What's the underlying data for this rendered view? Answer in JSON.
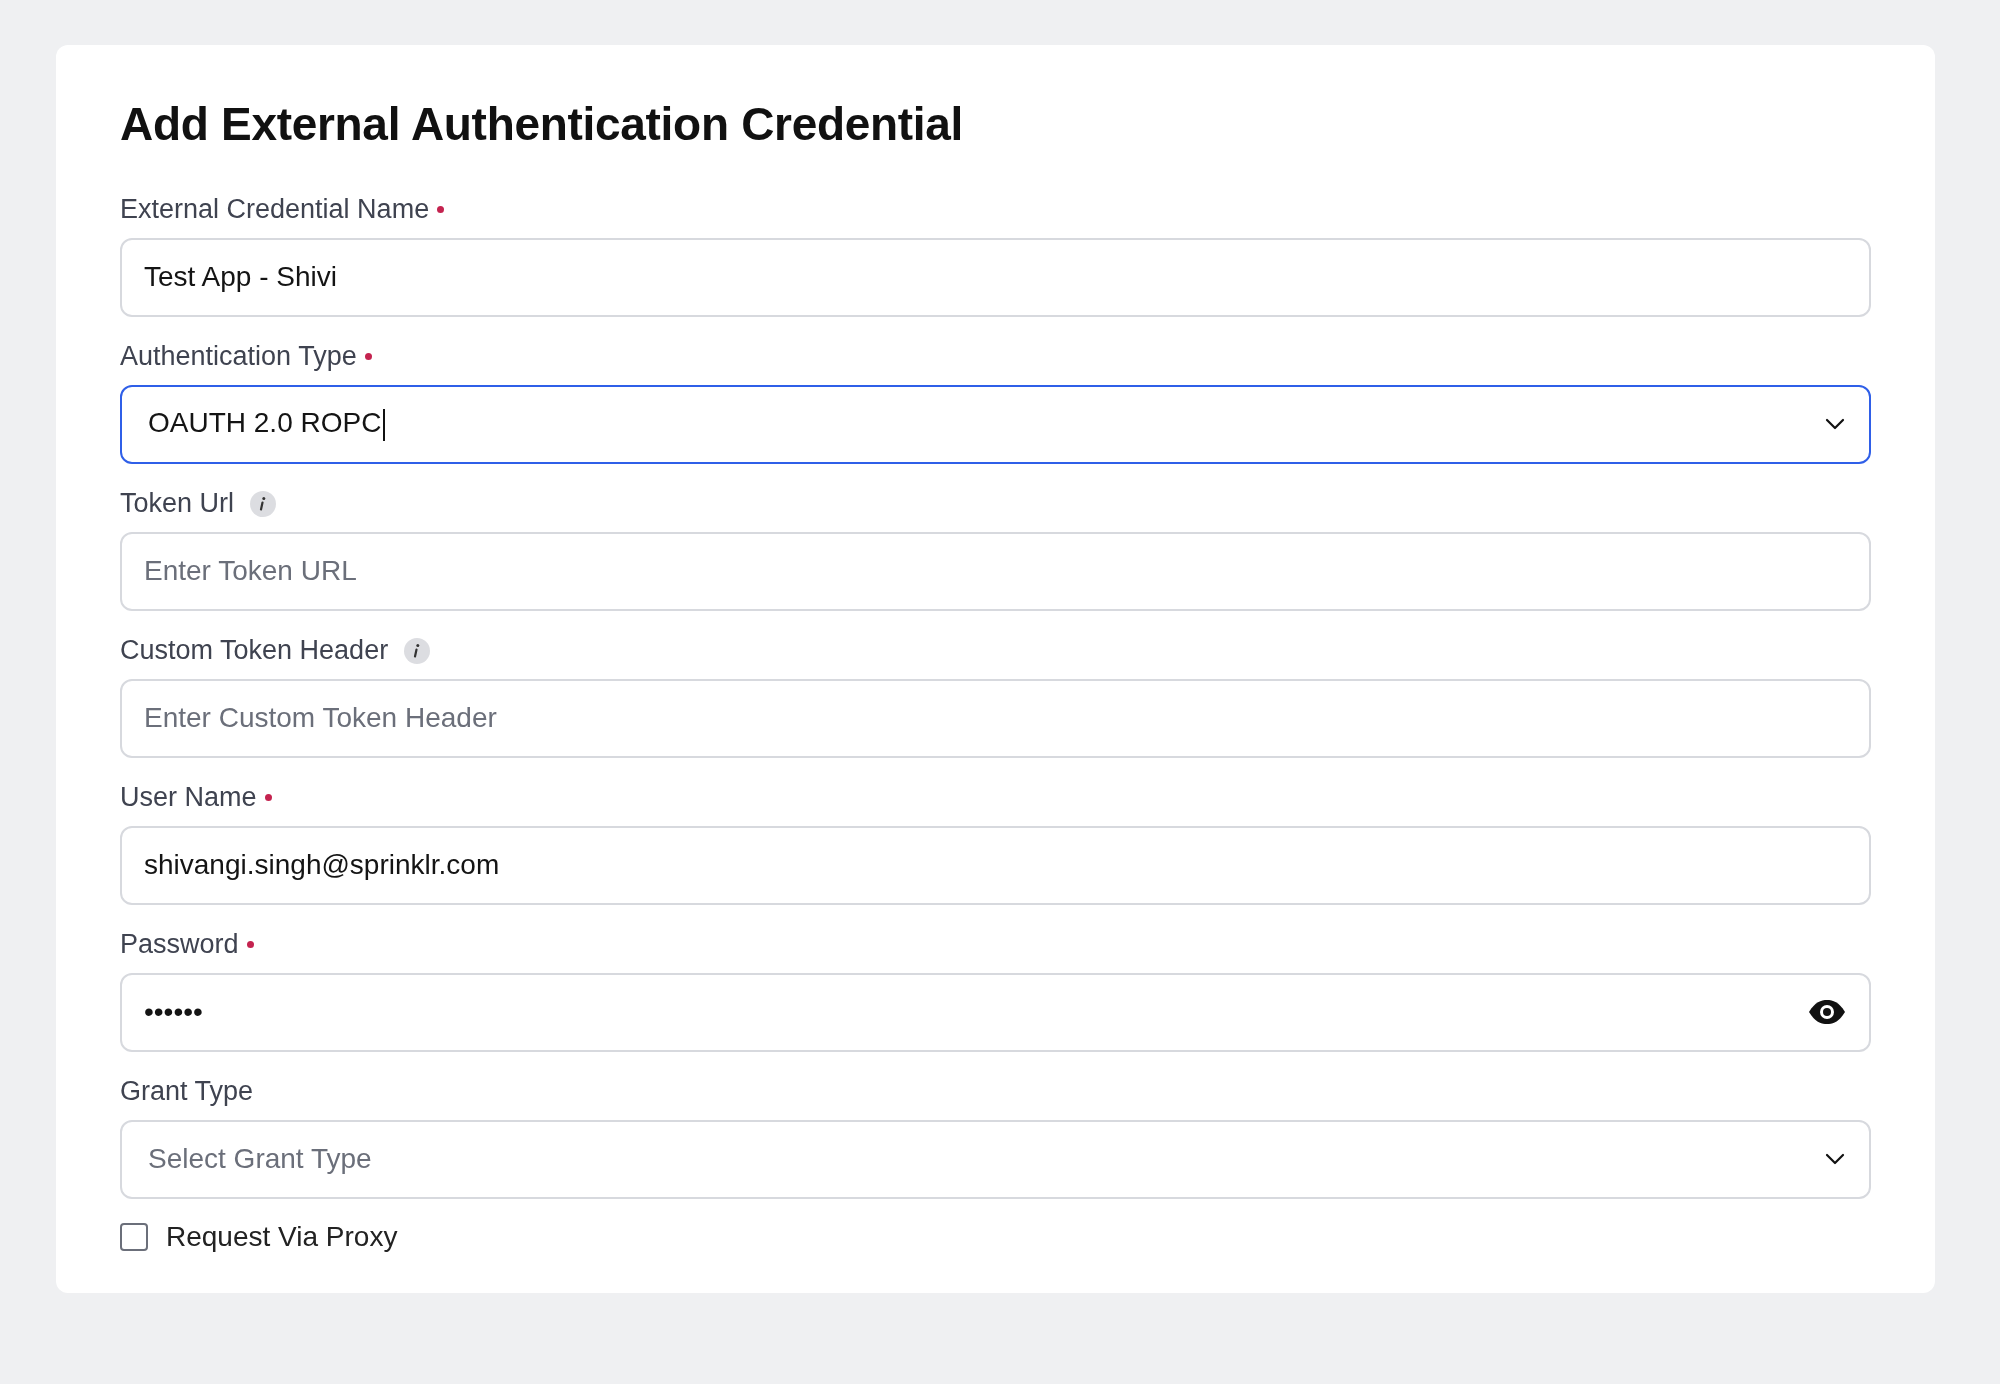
{
  "title": "Add External Authentication Credential",
  "fields": [
    {
      "kind": "text",
      "label": "External Credential Name",
      "required": true,
      "info": false,
      "value": "Test App - Shivi",
      "focused": false
    },
    {
      "kind": "select",
      "label": "Authentication Type",
      "required": true,
      "info": false,
      "value": "OAUTH 2.0 ROPC",
      "focused": true
    },
    {
      "kind": "text",
      "label": "Token Url",
      "required": false,
      "info": true,
      "placeholder": "Enter Token URL",
      "focused": false
    },
    {
      "kind": "text",
      "label": "Custom Token Header",
      "required": false,
      "info": true,
      "placeholder": "Enter Custom Token Header",
      "focused": false
    },
    {
      "kind": "text",
      "label": "User Name",
      "required": true,
      "info": false,
      "value": "shivangi.singh@sprinklr.com",
      "focused": false
    },
    {
      "kind": "password",
      "label": "Password",
      "required": true,
      "info": false,
      "value": "••••••",
      "focused": false
    },
    {
      "kind": "select",
      "label": "Grant Type",
      "required": false,
      "info": false,
      "placeholder": "Select Grant Type",
      "focused": false
    }
  ],
  "checkbox": {
    "label": "Request Via Proxy",
    "checked": false
  }
}
